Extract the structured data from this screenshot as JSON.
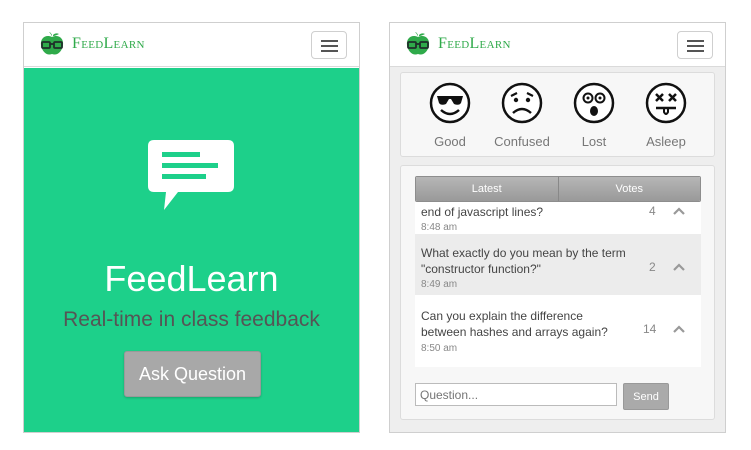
{
  "brand": {
    "name": "FeedLearn"
  },
  "left_screen": {
    "hero": {
      "title": "FeedLearn",
      "subtitle": "Real-time in class feedback",
      "ask_button": "Ask Question"
    }
  },
  "right_screen": {
    "moods": [
      {
        "label": "Good",
        "icon": "cool-face-icon"
      },
      {
        "label": "Confused",
        "icon": "confused-face-icon"
      },
      {
        "label": "Lost",
        "icon": "surprised-face-icon"
      },
      {
        "label": "Asleep",
        "icon": "dizzy-face-icon"
      }
    ],
    "tabs": [
      "Latest",
      "Votes"
    ],
    "questions": [
      {
        "text": "end of javascript lines?",
        "time": "8:48 am",
        "votes": "4"
      },
      {
        "text": "What exactly do you mean by the term \"constructor function?\"",
        "time": "8:49 am",
        "votes": "2"
      },
      {
        "text": "Can you explain the difference between hashes and arrays again?",
        "time": "8:50 am",
        "votes": "14"
      }
    ],
    "input_placeholder": "Question...",
    "send_label": "Send"
  },
  "colors": {
    "accent": "#1dd08a",
    "brand": "#2faa4a"
  }
}
